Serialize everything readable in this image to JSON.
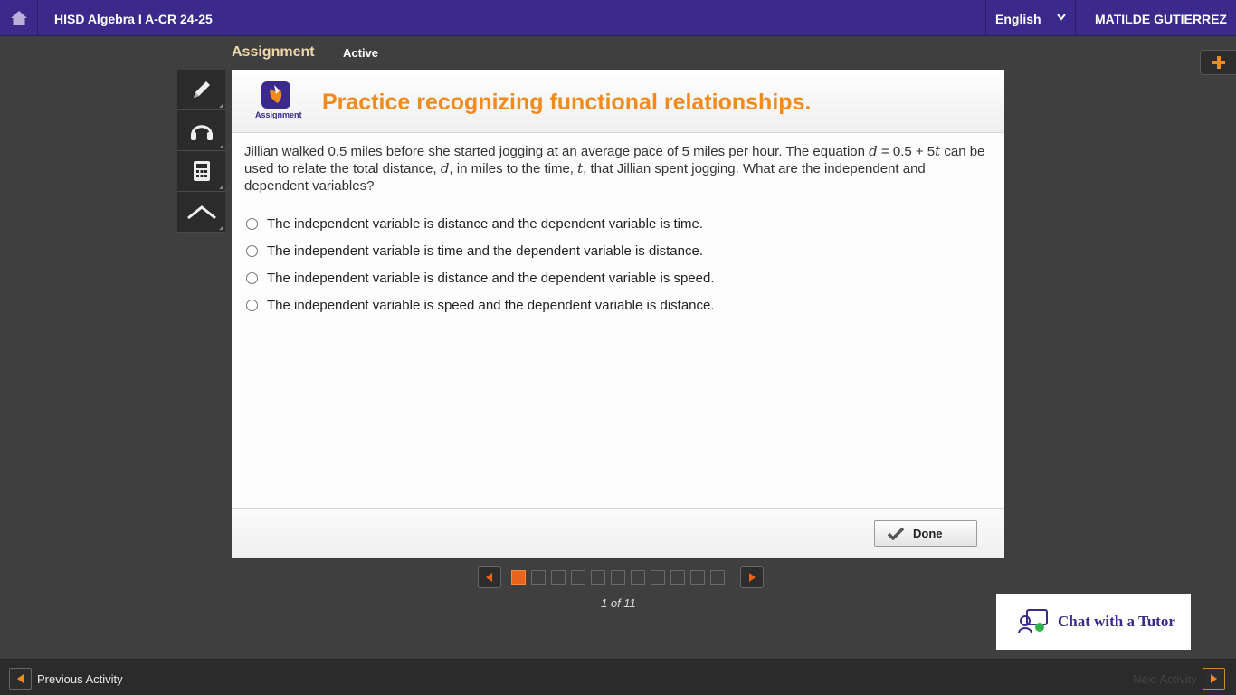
{
  "topbar": {
    "course_title": "HISD Algebra I A-CR 24-25",
    "language": "English",
    "user_name": "MATILDE GUTIERREZ"
  },
  "subheader": {
    "label": "Assignment",
    "status": "Active"
  },
  "tools": [
    "pencil-icon",
    "headphones-icon",
    "calculator-icon",
    "caret-up-icon"
  ],
  "card": {
    "logo_text": "Assignment",
    "title": "Practice recognizing functional relationships.",
    "question": {
      "part1": "Jillian walked 0.5 miles before she started jogging at an average pace of 5 miles per hour. The equation ",
      "eq_d": "d",
      "eq_mid": " = 0.5 + 5",
      "eq_t": "t",
      "part2": " can be used to relate the total distance, ",
      "var_d": "d",
      "part3": ", in miles to the time, ",
      "var_t": "t",
      "part4": ", that Jillian spent jogging. What are the independent and dependent variables?"
    },
    "options": [
      "The independent variable is distance and the dependent variable is time.",
      "The independent variable is time and the dependent variable is distance.",
      "The independent variable is distance and the dependent variable is speed.",
      "The independent variable is speed and the dependent variable is distance."
    ],
    "done_label": "Done"
  },
  "pager": {
    "total": 11,
    "current": 1,
    "count_text": "1 of 11"
  },
  "chat": {
    "label": "Chat with a Tutor"
  },
  "bottombar": {
    "prev_label": "Previous Activity",
    "next_label": "Next Activity"
  },
  "colors": {
    "brand": "#3b2a8a",
    "title_orange": "#f28a1c",
    "active_page": "#e8641a"
  }
}
